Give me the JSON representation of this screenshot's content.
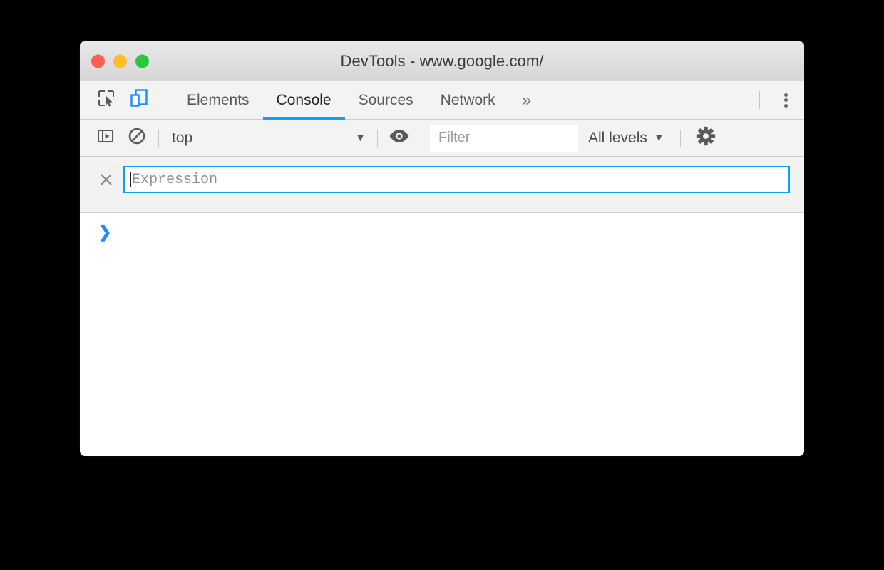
{
  "window": {
    "title": "DevTools - www.google.com/",
    "traffic_lights": [
      {
        "name": "close",
        "color": "#ff5f52"
      },
      {
        "name": "minimize",
        "color": "#fdbc2c"
      },
      {
        "name": "maximize",
        "color": "#2ac63b"
      }
    ]
  },
  "tabbar": {
    "inspect_icon": "inspect-element-icon",
    "device_icon": "device-toolbar-icon",
    "tabs": [
      {
        "label": "Elements",
        "active": false
      },
      {
        "label": "Console",
        "active": true
      },
      {
        "label": "Sources",
        "active": false
      },
      {
        "label": "Network",
        "active": false
      }
    ],
    "more_tabs_label": "»",
    "kebab_icon": "more-options-icon",
    "active_underline_color": "#0aa2f0"
  },
  "console_toolbar": {
    "sidebar_toggle_icon": "console-sidebar-icon",
    "clear_icon": "clear-console-icon",
    "context": {
      "value": "top",
      "arrow": "▼"
    },
    "live_expression_icon": "eye-icon",
    "filter": {
      "value": "",
      "placeholder": "Filter"
    },
    "levels": {
      "value": "All levels",
      "arrow": "▼"
    },
    "settings_icon": "gear-icon"
  },
  "live_expression": {
    "remove_label": "×",
    "value": "",
    "placeholder": "Expression",
    "focused": true,
    "focus_color": "#0aa2f0"
  },
  "console": {
    "prompt_chevron": "❯",
    "prompt_value": "",
    "messages": []
  }
}
